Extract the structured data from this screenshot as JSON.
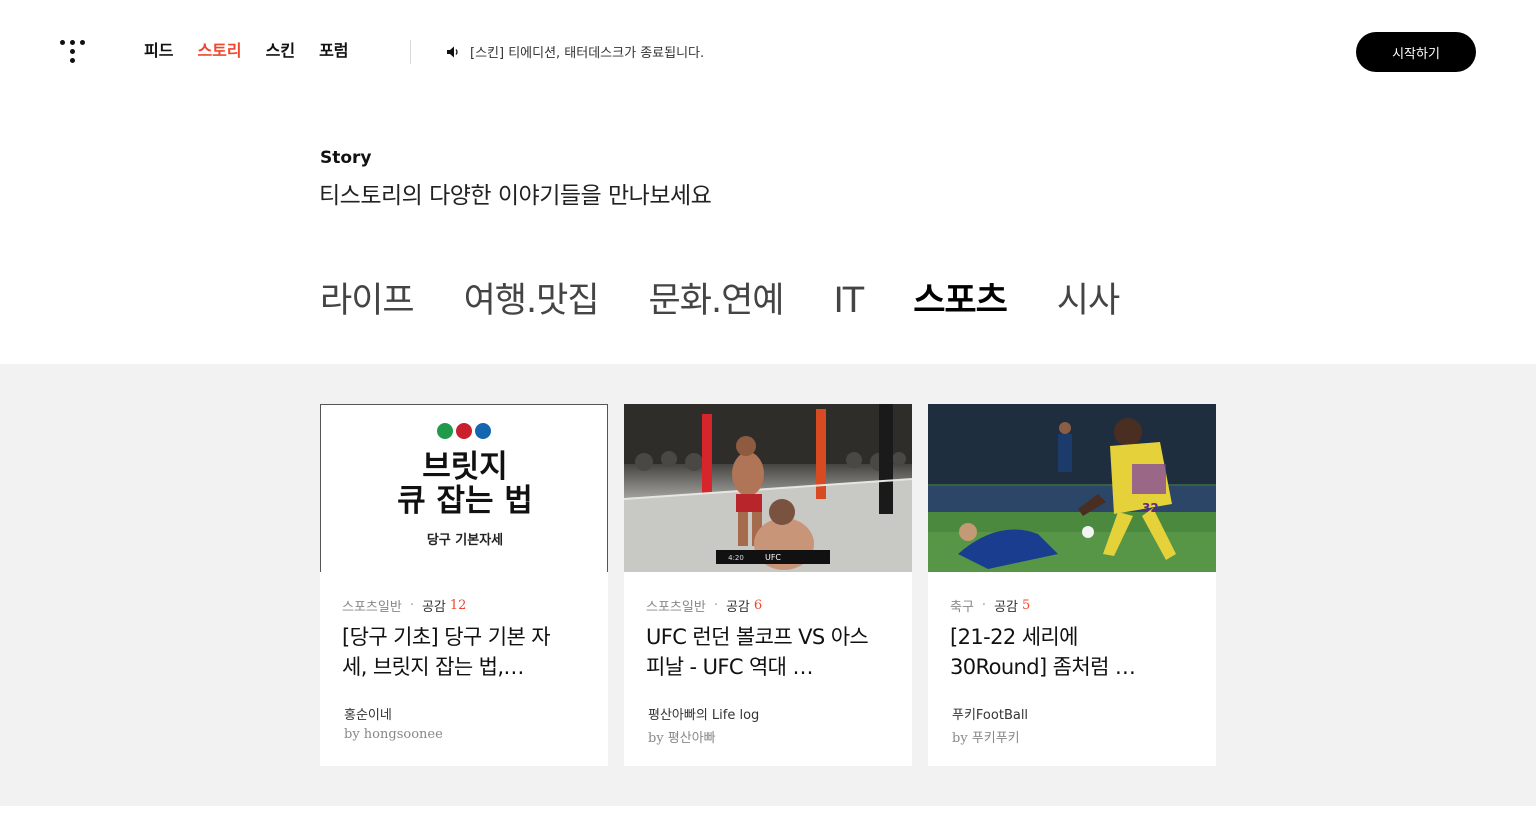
{
  "header": {
    "logo_icon": "tistory-logo-icon",
    "nav": [
      {
        "label": "피드",
        "active": false
      },
      {
        "label": "스토리",
        "active": true
      },
      {
        "label": "스킨",
        "active": false
      },
      {
        "label": "포럼",
        "active": false
      }
    ],
    "notice_icon": "speaker-icon",
    "notice_text": "[스킨] 티에디션, 태터데스크가 종료됩니다.",
    "start_label": "시작하기"
  },
  "intro": {
    "label": "Story",
    "title": "티스토리의 다양한 이야기들을 만나보세요"
  },
  "categories": [
    {
      "label": "라이프",
      "active": false
    },
    {
      "label": "여행.맛집",
      "active": false
    },
    {
      "label": "문화.연예",
      "active": false
    },
    {
      "label": "IT",
      "active": false
    },
    {
      "label": "스포츠",
      "active": true
    },
    {
      "label": "시사",
      "active": false
    }
  ],
  "colors": {
    "accent": "#f1462e",
    "content_bg": "#f2f2f2"
  },
  "cards": [
    {
      "thumb": {
        "line1": "브릿지",
        "line2": "큐 잡는 법",
        "sub": "당구 기본자세",
        "ball_colors": [
          "#1e9a4a",
          "#c9202c",
          "#1466b0"
        ]
      },
      "category": "스포츠일반",
      "likes_label": "공감",
      "likes": "12",
      "title": "[당구 기초] 당구 기본 자세, 브릿지 잡는 법,…",
      "blog": "홍순이네",
      "author": "by hongsoonee"
    },
    {
      "thumb": {
        "scoreboard_label": "UFC",
        "time": "4:20"
      },
      "category": "스포츠일반",
      "likes_label": "공감",
      "likes": "6",
      "title": "UFC 런던 볼코프 VS 아스피날 - UFC 역대 …",
      "blog": "평산아빠의 Life log",
      "author": "by 평산아빠"
    },
    {
      "thumb": {
        "jersey_number": "32"
      },
      "category": "축구",
      "likes_label": "공감",
      "likes": "5",
      "title": "[21-22 세리에 30Round] 좀처럼 …",
      "blog": "푸키FootBall",
      "author": "by 푸키푸키"
    }
  ]
}
